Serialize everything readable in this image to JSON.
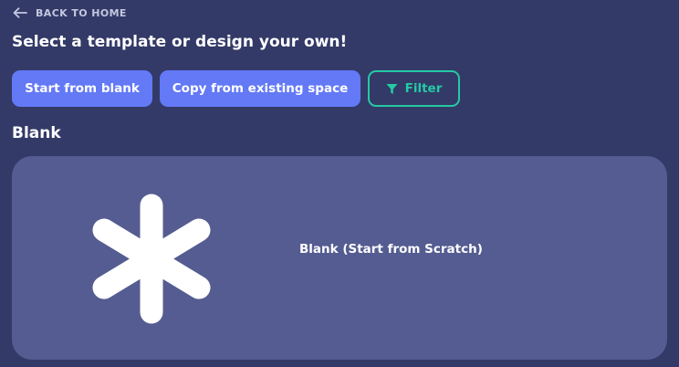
{
  "nav": {
    "back_label": "BACK TO HOME",
    "back_icon": "arrow-left-icon"
  },
  "header": {
    "title": "Select a template or design your own!"
  },
  "actions": {
    "start_blank_label": "Start from blank",
    "copy_existing_label": "Copy from existing space",
    "filter_label": "Filter",
    "filter_icon": "filter-funnel-icon"
  },
  "section": {
    "title": "Blank"
  },
  "templates": [
    {
      "label": "Blank (Start from Scratch)",
      "icon": "asterisk-icon"
    }
  ],
  "colors": {
    "background": "#333a67",
    "primary_button": "#6379f6",
    "filter_accent": "#25c9a4",
    "card_background": "#545c91",
    "text": "#ffffff",
    "muted_text": "#c3c7e0"
  }
}
